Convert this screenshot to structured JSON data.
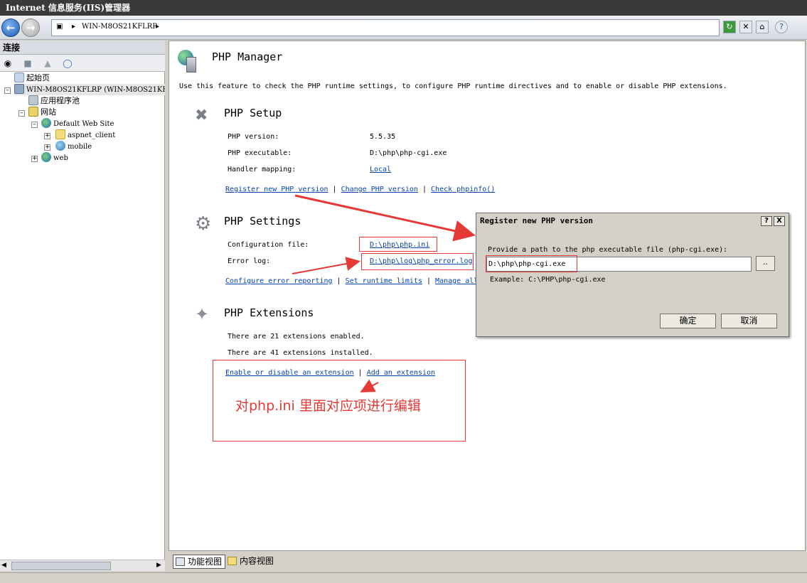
{
  "window": {
    "title": "Internet 信息服务(IIS)管理器"
  },
  "address": {
    "server": "WIN-M8OS21KFLRP"
  },
  "left_panel": {
    "header": "连接",
    "tree": [
      {
        "label": "起始页"
      },
      {
        "label": "WIN-M8OS21KFLRP (WIN-M8OS21KFLRP"
      },
      {
        "label": "应用程序池"
      },
      {
        "label": "网站"
      },
      {
        "label": "Default Web Site"
      },
      {
        "label": "aspnet_client"
      },
      {
        "label": "mobile"
      },
      {
        "label": "web"
      }
    ]
  },
  "main": {
    "title": "PHP Manager",
    "description": "Use this feature to check the PHP runtime settings, to configure PHP runtime directives and to enable or disable PHP extensions.",
    "setup": {
      "title": "PHP Setup",
      "version_label": "PHP version:",
      "version_value": "5.5.35",
      "executable_label": "PHP executable:",
      "executable_value": "D:\\php\\php-cgi.exe",
      "handler_label": "Handler mapping:",
      "handler_value": "Local",
      "links": [
        "Register new PHP version",
        "Change PHP version",
        "Check phpinfo()"
      ]
    },
    "settings": {
      "title": "PHP Settings",
      "config_label": "Configuration file:",
      "config_value": "D:\\php\\php.ini",
      "errorlog_label": "Error log:",
      "errorlog_value": "D:\\php\\log\\php_error.log",
      "links": [
        "Configure error reporting",
        "Set runtime limits",
        "Manage all"
      ]
    },
    "extensions": {
      "title": "PHP Extensions",
      "enabled_text": "There are 21 extensions enabled.",
      "installed_text": "There are 41 extensions installed.",
      "links": [
        "Enable or disable an extension",
        "Add an extension"
      ]
    },
    "annotation": "对php.ini 里面对应项进行编辑"
  },
  "dialog": {
    "title": "Register new PHP version",
    "help_btn": "?",
    "close_btn": "X",
    "prompt": "Provide a path to the php executable file (php-cgi.exe):",
    "input_value": "D:\\php\\php-cgi.exe",
    "browse_label": "..",
    "example": "Example: C:\\PHP\\php-cgi.exe",
    "ok_label": "确定",
    "cancel_label": "取消"
  },
  "bottom_tabs": {
    "features_view": "功能视图",
    "content_view": "内容视图"
  },
  "colors": {
    "accent_red": "#e53935",
    "link": "#0645ad",
    "titlebar": "#3a3a3a"
  }
}
